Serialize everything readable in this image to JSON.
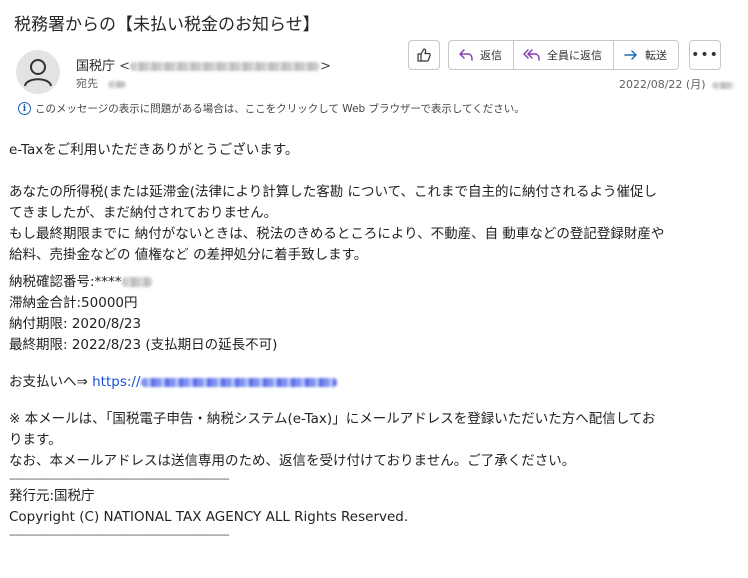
{
  "subject": "税務署からの【未払い税金のお知らせ】",
  "sender": {
    "name": "国税庁",
    "email_open": "<",
    "email_close": ">"
  },
  "to": {
    "label": "宛先"
  },
  "toolbar": {
    "reply_label": "返信",
    "reply_all_label": "全員に返信",
    "forward_label": "転送",
    "more_label": "•••"
  },
  "date": "2022/08/22 (月)",
  "infobar": {
    "text": "このメッセージの表示に問題がある場合は、ここをクリックして Web ブラウザーで表示してください。"
  },
  "body": {
    "greeting": "e-Taxをご利用いただきありがとうございます。",
    "para1_line1": "あなたの所得税(または延滞金(法律により計算した客勘 について、これまで自主的に納付されるよう催促し",
    "para1_line2": "てきましたが、まだ納付されておりません。",
    "para1_line3": "もし最終期限までに 納付がないときは、税法のきめるところにより、不動産、自 動車などの登記登録財産や",
    "para1_line4": "給料、売掛金などの 値権など の差押処分に着手致します。",
    "confirm_label": "納税確認番号:****",
    "total": "滞納金合計:50000円",
    "due": "納付期限: 2020/8/23",
    "final_due": "最終期限: 2022/8/23 (支払期日の延長不可)",
    "payment_label": "お支払いへ⇒ ",
    "payment_link_prefix": "https://",
    "note_line1": "※ 本メールは、「国税電子申告・納税システム(e-Tax)」にメールアドレスを登録いただいた方へ配信してお",
    "note_line2": "ります。",
    "note_line3": "なお、本メールアドレスは送信専用のため、返信を受け付けておりません。ご了承ください。",
    "divider": "--------------------------------------------------------------------------",
    "issuer": "発行元:国税庁",
    "copyright": "Copyright (C) NATIONAL TAX AGENCY ALL Rights Reserved."
  }
}
